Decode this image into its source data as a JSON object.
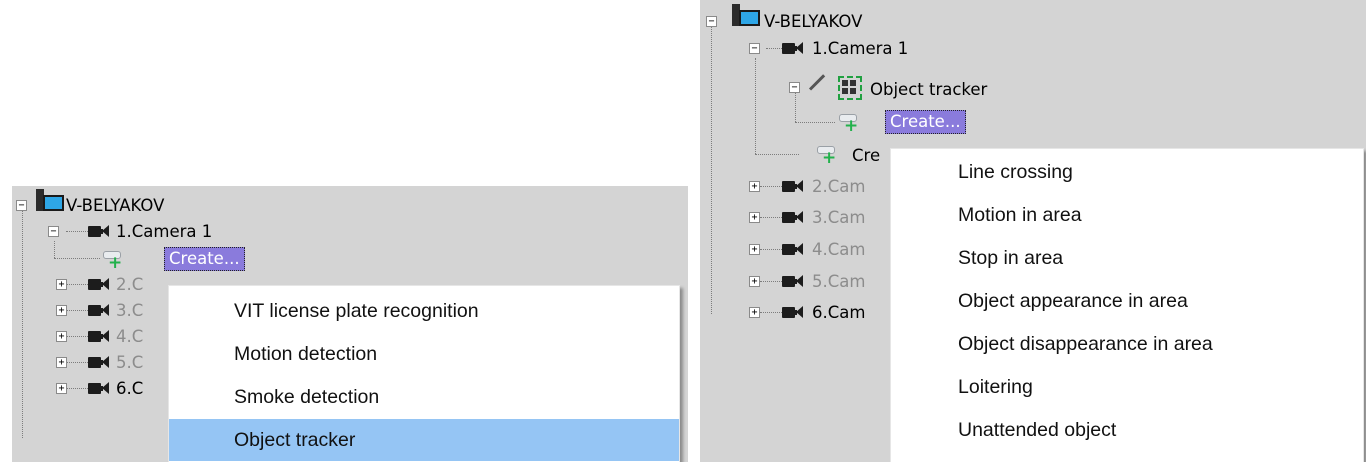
{
  "left": {
    "root_label": "V-BELYAKOV",
    "camera1_label": "1.Camera 1",
    "create_label": "Create...",
    "collapsed_cameras": [
      "2.C",
      "3.C",
      "4.C",
      "5.C",
      "6.C"
    ],
    "menu_items": [
      {
        "label": "VIT license plate recognition",
        "highlighted": false
      },
      {
        "label": "Motion detection",
        "highlighted": false
      },
      {
        "label": "Smoke detection",
        "highlighted": false
      },
      {
        "label": "Object tracker",
        "highlighted": true
      }
    ]
  },
  "right": {
    "root_label": "V-BELYAKOV",
    "camera1_label": "1.Camera 1",
    "tracker_label": "Object tracker",
    "create_label": "Create...",
    "create2_label": "Cre",
    "collapsed_cameras": [
      "2.Cam",
      "3.Cam",
      "4.Cam",
      "5.Cam",
      "6.Cam"
    ],
    "menu_items": [
      {
        "label": "Line crossing"
      },
      {
        "label": "Motion in area"
      },
      {
        "label": "Stop in area"
      },
      {
        "label": "Object appearance in area"
      },
      {
        "label": "Object disappearance in area"
      },
      {
        "label": "Loitering"
      },
      {
        "label": "Unattended object"
      }
    ]
  },
  "colors": {
    "panel_bg": "#d4d4d4",
    "selection_bg": "#8a7bdc",
    "menu_highlight": "#95c5f4",
    "add_plus": "#22b14c",
    "monitor": "#2ea6e6"
  }
}
